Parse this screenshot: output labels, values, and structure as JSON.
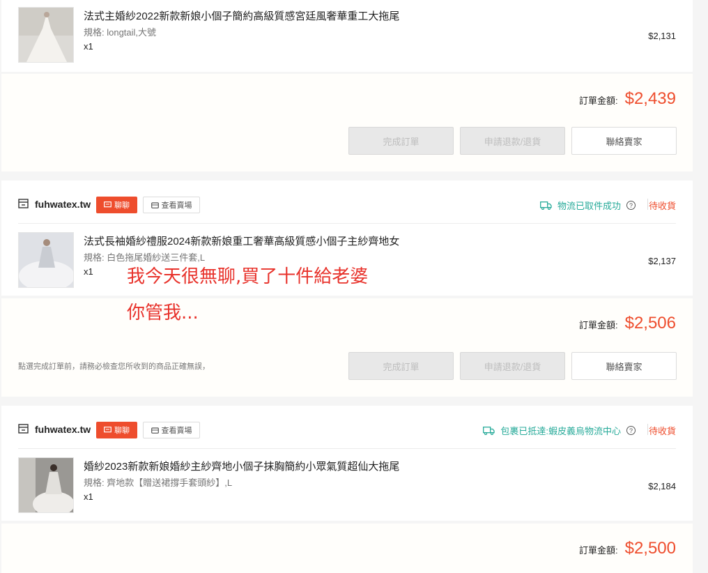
{
  "orders": [
    {
      "product": {
        "title": "法式主婚紗2022新款新娘小個子簡約高級質感宮廷風奢華重工大拖尾",
        "spec": "規格: longtail,大號",
        "qty": "x1",
        "price": "$2,131"
      },
      "total_label": "訂單金額:",
      "total_amount": "$2,439",
      "buttons": {
        "complete": "完成訂單",
        "refund": "申請退款/退貨",
        "contact": "聯絡賣家"
      }
    },
    {
      "shop_name": "fuhwatex.tw",
      "chat_label": "聊聊",
      "view_shop_label": "查看賣場",
      "logistics": "物流已取件成功",
      "status": "待收貨",
      "product": {
        "title": "法式長袖婚紗禮服2024新款新娘重工奢華高級質感小個子主紗齊地女",
        "spec": "規格: 白色拖尾婚紗送三件套,L",
        "qty": "x1",
        "price": "$2,137"
      },
      "total_label": "訂單金額:",
      "total_amount": "$2,506",
      "hint": "點選完成訂單前，請務必檢查您所收到的商品正確無誤，",
      "buttons": {
        "complete": "完成訂單",
        "refund": "申請退款/退貨",
        "contact": "聯絡賣家"
      }
    },
    {
      "shop_name": "fuhwatex.tw",
      "chat_label": "聊聊",
      "view_shop_label": "查看賣場",
      "logistics": "包裹已抵達:蝦皮義烏物流中心",
      "status": "待收貨",
      "product": {
        "title": "婚紗2023新款新娘婚紗主紗齊地小個子抹胸簡約小眾氣質超仙大拖尾",
        "spec": "規格: 齊地款【贈送裙撐手套頭紗】,L",
        "qty": "x1",
        "price": "$2,184"
      },
      "total_label": "訂單金額:",
      "total_amount": "$2,500"
    }
  ],
  "overlay_text": {
    "line1": "我今天很無聊,買了十件給老婆",
    "line2": "你管我..."
  },
  "colors": {
    "accent": "#ee4d2d",
    "logistics": "#26aa99",
    "overlay": "#e8322b"
  },
  "icons": [
    "shop-icon",
    "chat-icon",
    "store-icon",
    "truck-icon",
    "help-icon"
  ]
}
